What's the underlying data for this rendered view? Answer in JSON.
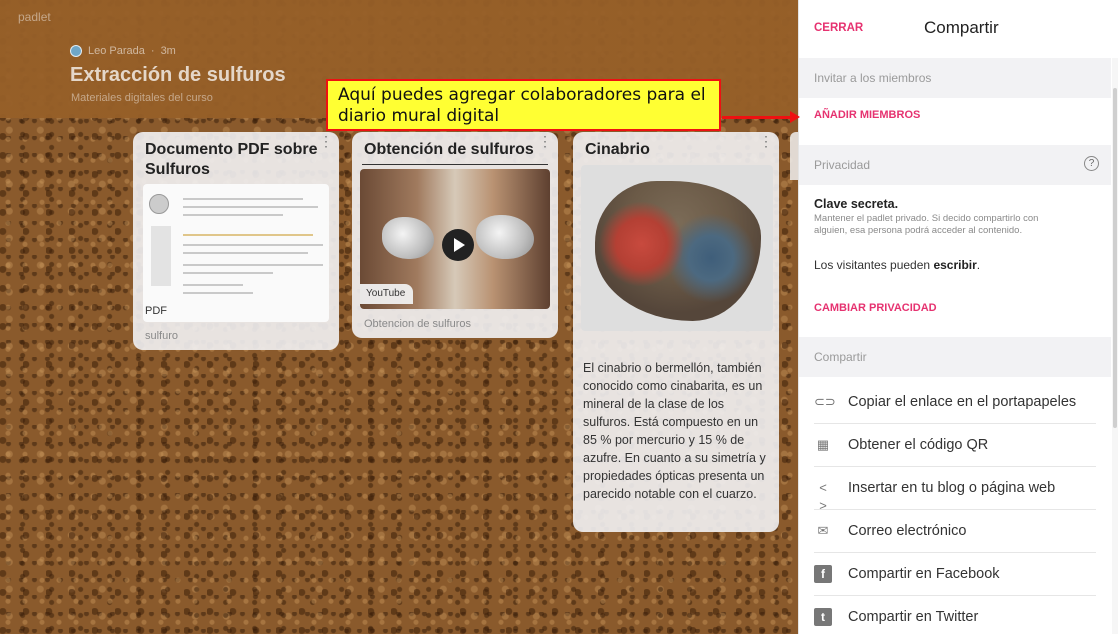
{
  "board": {
    "brand": "padlet",
    "author": "Leo Parada",
    "time": "3m",
    "title": "Extracción de sulfuros",
    "subtitle": "Materiales digitales del curso"
  },
  "callout": {
    "text": "Aquí puedes agregar colaboradores para el diario mural digital"
  },
  "cards": {
    "pdf": {
      "title": "Documento PDF sobre Sulfuros",
      "file_type": "PDF",
      "caption": "sulfuro"
    },
    "video": {
      "title": "Obtención de sulfuros",
      "source": "YouTube",
      "caption": "Obtencion de sulfuros"
    },
    "cinabrio": {
      "title": "Cinabrio",
      "text": "El cinabrio o bermellón, también conocido como cinabarita, es un mineral de la clase de los sulfuros. Está compuesto en un 85 % por mercurio y 15 % de azufre. En cuanto a su simetría y propiedades ópticas presenta un parecido notable con el cuarzo."
    }
  },
  "panel": {
    "close_label": "CERRAR",
    "title": "Compartir",
    "invite_section": "Invitar a los miembros",
    "add_members": "AÑADIR MIEMBROS",
    "privacy_section": "Privacidad",
    "help_glyph": "?",
    "privacy_title": "Clave secreta.",
    "privacy_desc": "Mantener el padlet privado. Si decido compartirlo con alguien, esa persona podrá acceder al contenido.",
    "visitors_prefix": "Los visitantes pueden",
    "visitors_action": "escribir",
    "visitors_suffix": ".",
    "change_privacy": "CAMBIAR PRIVACIDAD",
    "share_section": "Compartir",
    "share_items": [
      {
        "icon": "link-icon",
        "label": "Copiar el enlace en el portapapeles"
      },
      {
        "icon": "qr-code-icon",
        "label": "Obtener el código QR"
      },
      {
        "icon": "embed-code-icon",
        "label": "Insertar en tu blog o página web"
      },
      {
        "icon": "email-icon",
        "label": "Correo electrónico"
      },
      {
        "icon": "facebook-icon",
        "label": "Compartir en Facebook"
      },
      {
        "icon": "twitter-icon",
        "label": "Compartir en Twitter"
      }
    ]
  },
  "colors": {
    "accent": "#e63270",
    "callout_bg": "#ffff33",
    "callout_border": "#ee1111",
    "board": "#8a5a2c"
  }
}
